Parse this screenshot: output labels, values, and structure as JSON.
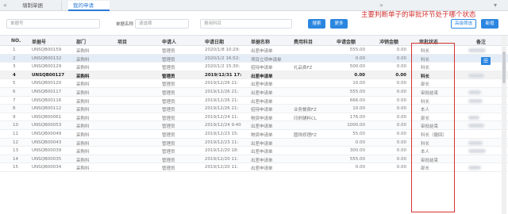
{
  "tabs": [
    {
      "label": "填制单据"
    },
    {
      "label": "我的申请"
    }
  ],
  "nav": {
    "back_icon": "«",
    "forward_icon": "»"
  },
  "search": {
    "doc_no_placeholder": "单据号",
    "doc_name_label": "单据名称",
    "doc_name_placeholder": "请选择",
    "expense_placeholder": "费用科目",
    "search_btn": "搜索",
    "more_btn": "更多",
    "advanced_btn": "高级筛选",
    "add_btn": "新增"
  },
  "annotation": "主要判断单子的审批环节处于哪个状态",
  "columns": [
    "NO.",
    "单据号",
    "部门",
    "项目",
    "申请人",
    "申请日期",
    "单据名称",
    "费用科目",
    "申请金额",
    "冲销金额",
    "审批状态",
    "备注"
  ],
  "rows": [
    {
      "no": "1",
      "doc": "UNSQB00159",
      "dept": "采购科",
      "project": "",
      "applicant": "管理员",
      "date": "2020/1/8 10:29:",
      "name": "出差申请单",
      "expense": "",
      "amount": "555.00",
      "offset": "0.00",
      "status": "科长"
    },
    {
      "no": "2",
      "doc": "UNSQB00132",
      "dept": "采购科",
      "project": "",
      "applicant": "管理员",
      "date": "2020/1/2 16:52:",
      "name": "项目立项申请单",
      "expense": "",
      "amount": "0.00",
      "offset": "0.00",
      "status": "科长"
    },
    {
      "no": "3",
      "doc": "UNSQB00129",
      "dept": "采购科",
      "project": "",
      "applicant": "管理员",
      "date": "2020/1/2 15:30:",
      "name": "招待申请单",
      "expense": "礼品费FZ",
      "amount": "500.00",
      "offset": "0.00",
      "status": "科长"
    },
    {
      "no": "4",
      "doc": "UNSQB00127",
      "dept": "采购科",
      "project": "",
      "applicant": "管理员",
      "date": "2019/12/31 17:",
      "name": "出差申请单",
      "expense": "",
      "amount": "0.00",
      "offset": "0.00",
      "status": "科长"
    },
    {
      "no": "5",
      "doc": "UNSQB00120",
      "dept": "采购科",
      "project": "",
      "applicant": "管理员",
      "date": "2019/12/26 21:",
      "name": "出差申请单",
      "expense": "",
      "amount": "10.00",
      "offset": "0.00",
      "status": "部长"
    },
    {
      "no": "6",
      "doc": "UNSQB00117",
      "dept": "采购科",
      "project": "",
      "applicant": "管理员",
      "date": "2019/12/26 21:",
      "name": "出差申请单",
      "expense": "",
      "amount": "555.00",
      "offset": "0.00",
      "status": "审批结束"
    },
    {
      "no": "7",
      "doc": "UNSQB00116",
      "dept": "采购科",
      "project": "",
      "applicant": "管理员",
      "date": "2019/12/26 21:",
      "name": "出差申请单",
      "expense": "",
      "amount": "666.00",
      "offset": "0.00",
      "status": "科长"
    },
    {
      "no": "8",
      "doc": "UNSQB00112",
      "dept": "采购科",
      "project": "",
      "applicant": "管理员",
      "date": "2019/12/26 21:",
      "name": "招待申请单",
      "expense": "业务餐费FZ",
      "amount": "10.00",
      "offset": "0.00",
      "status": "本人"
    },
    {
      "no": "9",
      "doc": "UNSQB00061",
      "dept": "采购科",
      "project": "",
      "applicant": "管理员",
      "date": "2019/12/24 11:",
      "name": "物资申请单",
      "expense": "印刷辅料CL",
      "amount": "176.00",
      "offset": "0.00",
      "status": "部长"
    },
    {
      "no": "10",
      "doc": "UNSQB00053",
      "dept": "采购科",
      "project": "",
      "applicant": "管理员",
      "date": "2019/12/24 9:40",
      "name": "出差申请单",
      "expense": "",
      "amount": "1000.00",
      "offset": "0.00",
      "status": "审批结束"
    },
    {
      "no": "11",
      "doc": "UNSQB00049",
      "dept": "采购科",
      "project": "",
      "applicant": "管理员",
      "date": "2019/12/23 15:",
      "name": "物资申请单",
      "expense": "圆珠修理FZ",
      "amount": "55.00",
      "offset": "0.00",
      "status": "科长（撤回）"
    },
    {
      "no": "12",
      "doc": "UNSQB00043",
      "dept": "采购科",
      "project": "",
      "applicant": "管理员",
      "date": "2019/12/23 11:",
      "name": "出差申请单",
      "expense": "",
      "amount": "0.00",
      "offset": "0.00",
      "status": "科长"
    },
    {
      "no": "13",
      "doc": "UNSQB00039",
      "dept": "采购科",
      "project": "",
      "applicant": "管理员",
      "date": "2019/12/20 18:",
      "name": "出差申请单",
      "expense": "",
      "amount": "300.00",
      "offset": "0.00",
      "status": "本人"
    },
    {
      "no": "14",
      "doc": "UNSQB00035",
      "dept": "采购科",
      "project": "",
      "applicant": "管理员",
      "date": "2019/12/20 11:",
      "name": "出差申请单",
      "expense": "",
      "amount": "555.00",
      "offset": "0.00",
      "status": "审批结束"
    },
    {
      "no": "15",
      "doc": "UNSQB00034",
      "dept": "采购科",
      "project": "",
      "applicant": "管理员",
      "date": "2019/12/20 11:",
      "name": "出差申请单",
      "expense": "",
      "amount": "0.00",
      "offset": "0.00",
      "status": "部长"
    }
  ]
}
